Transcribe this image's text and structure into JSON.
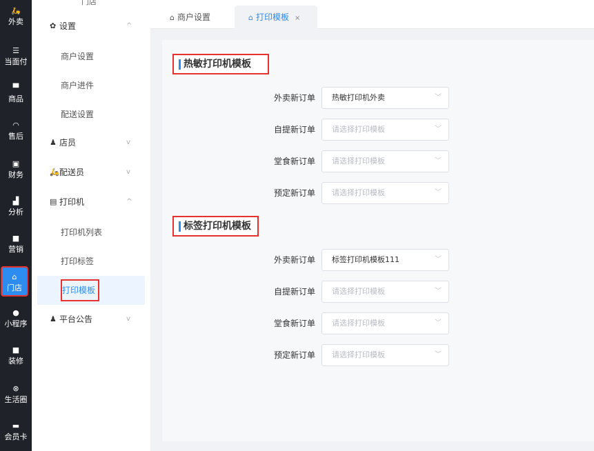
{
  "rail": [
    {
      "icon": "bike-icon",
      "glyph": "🛵",
      "label": "外卖"
    },
    {
      "icon": "list-icon",
      "glyph": "☰",
      "label": "当面付"
    },
    {
      "icon": "bag-icon",
      "glyph": "▀",
      "label": "商品"
    },
    {
      "icon": "headset-icon",
      "glyph": "◠",
      "label": "售后"
    },
    {
      "icon": "finance-icon",
      "glyph": "▣",
      "label": "财务"
    },
    {
      "icon": "bar-chart-icon",
      "glyph": "▟",
      "label": "分析"
    },
    {
      "icon": "gift-icon",
      "glyph": "■",
      "label": "营销"
    },
    {
      "icon": "store-icon",
      "glyph": "⌂",
      "label": "门店"
    },
    {
      "icon": "wechat-icon",
      "glyph": "●",
      "label": "小程序"
    },
    {
      "icon": "decor-icon",
      "glyph": "■",
      "label": "装修"
    },
    {
      "icon": "circle-icon",
      "glyph": "⊗",
      "label": "生活圈"
    },
    {
      "icon": "card-icon",
      "glyph": "▬",
      "label": "会员卡"
    }
  ],
  "submenu": {
    "top_partial": "门店",
    "settings": {
      "label": "设置",
      "icon": "gear-icon",
      "glyph": "✿",
      "arrow": "^"
    },
    "settings_items": [
      "商户设置",
      "商户进件",
      "配送设置"
    ],
    "staff": {
      "label": "店员",
      "icon": "staff-icon",
      "glyph": "♟",
      "arrow": "v"
    },
    "courier": {
      "label": "配送员",
      "icon": "courier-icon",
      "glyph": "🛵",
      "arrow": "v"
    },
    "printer": {
      "label": "打印机",
      "icon": "printer-icon",
      "glyph": "▤",
      "arrow": "^"
    },
    "printer_items": [
      "打印机列表",
      "打印标签",
      "打印模板"
    ],
    "notice": {
      "label": "平台公告",
      "icon": "notice-icon",
      "glyph": "♟",
      "arrow": "v"
    }
  },
  "tabs": [
    {
      "label": "商户设置",
      "icon": "store-icon",
      "glyph": "⌂"
    },
    {
      "label": "打印模板",
      "icon": "store-icon",
      "glyph": "⌂",
      "close": "×"
    }
  ],
  "sections": [
    {
      "title": "热敏打印机模板",
      "rows": [
        {
          "label": "外卖新订单",
          "value": "热敏打印机外卖",
          "placeholder": false
        },
        {
          "label": "自提新订单",
          "value": "请选择打印模板",
          "placeholder": true
        },
        {
          "label": "堂食新订单",
          "value": "请选择打印模板",
          "placeholder": true
        },
        {
          "label": "预定新订单",
          "value": "请选择打印模板",
          "placeholder": true
        }
      ]
    },
    {
      "title": "标签打印机模板",
      "rows": [
        {
          "label": "外卖新订单",
          "value": "标签打印机模板111",
          "placeholder": false
        },
        {
          "label": "自提新订单",
          "value": "请选择打印模板",
          "placeholder": true
        },
        {
          "label": "堂食新订单",
          "value": "请选择打印模板",
          "placeholder": true
        },
        {
          "label": "预定新订单",
          "value": "请选择打印模板",
          "placeholder": true
        }
      ]
    }
  ],
  "select_arrow": "﹀",
  "colors": {
    "accent": "#2d8cf0",
    "highlight_border": "#e8312c",
    "rail_bg": "#1f2329"
  }
}
